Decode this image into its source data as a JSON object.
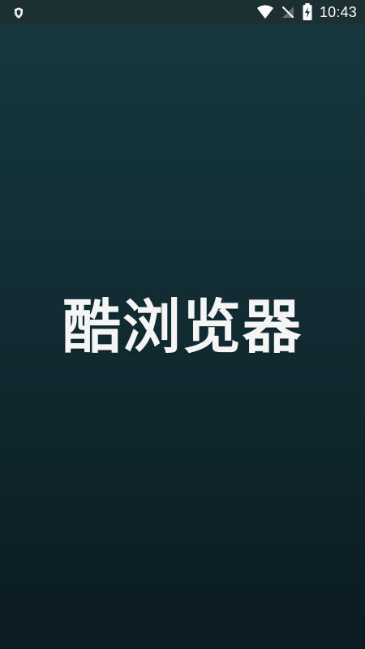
{
  "status_bar": {
    "time": "10:43",
    "icons": {
      "left": "shield-icon",
      "wifi": "wifi-icon",
      "signal": "no-signal-icon",
      "battery": "battery-charging-icon"
    }
  },
  "splash": {
    "title": "酷浏览器"
  },
  "colors": {
    "background_top": "#16393f",
    "background_bottom": "#0b1b22",
    "status_bar": "#1c2f33",
    "text": "#f5f5f5"
  }
}
